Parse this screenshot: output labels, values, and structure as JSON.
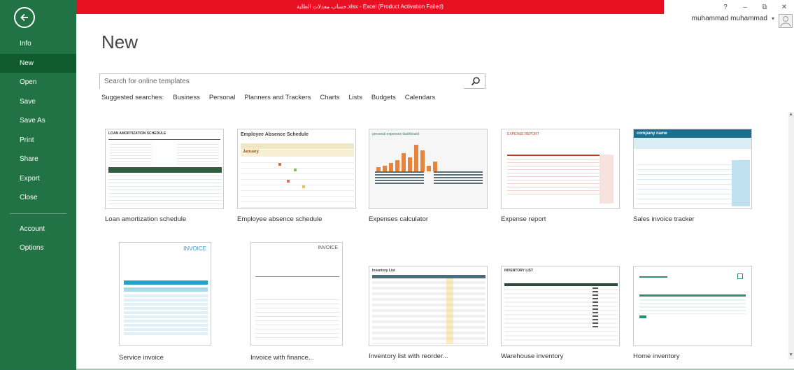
{
  "window": {
    "title": "حساب معدلات الطلبة.xlsx  -  Excel (Product Activation Failed)",
    "help": "?",
    "minimize": "–",
    "restore": "⧉",
    "close": "✕"
  },
  "user": {
    "name": "muhammad muhammad",
    "caret": "▾"
  },
  "sidebar": {
    "items": [
      {
        "label": "Info"
      },
      {
        "label": "New"
      },
      {
        "label": "Open"
      },
      {
        "label": "Save"
      },
      {
        "label": "Save As"
      },
      {
        "label": "Print"
      },
      {
        "label": "Share"
      },
      {
        "label": "Export"
      },
      {
        "label": "Close"
      },
      {
        "label": "Account"
      },
      {
        "label": "Options"
      }
    ]
  },
  "main": {
    "title": "New",
    "search": {
      "placeholder": "Search for online templates"
    },
    "suggested_label": "Suggested searches:",
    "suggested": [
      "Business",
      "Personal",
      "Planners and Trackers",
      "Charts",
      "Lists",
      "Budgets",
      "Calendars"
    ]
  },
  "templates": [
    {
      "label": "Loan amortization schedule",
      "thumb_title": "LOAN AMORTIZATION SCHEDULE"
    },
    {
      "label": "Employee absence schedule",
      "thumb_title": "Employee Absence Schedule",
      "thumb_month": "January"
    },
    {
      "label": "Expenses calculator",
      "thumb_title": "personal expenses dashboard"
    },
    {
      "label": "Expense report",
      "thumb_title": "EXPENSE REPORT"
    },
    {
      "label": "Sales invoice tracker",
      "thumb_title": "company name"
    },
    {
      "label": "Service invoice",
      "thumb_title": "INVOICE"
    },
    {
      "label": "Invoice with finance...",
      "thumb_title": "INVOICE"
    },
    {
      "label": "Inventory list with reorder...",
      "thumb_title": "Inventory List"
    },
    {
      "label": "Warehouse inventory",
      "thumb_title": "INVENTORY LIST"
    },
    {
      "label": "Home inventory",
      "thumb_title": ""
    }
  ],
  "colors": {
    "sidebar": "#217346",
    "sidebar_active": "#0f5a2f",
    "titlebar": "#e81123"
  }
}
